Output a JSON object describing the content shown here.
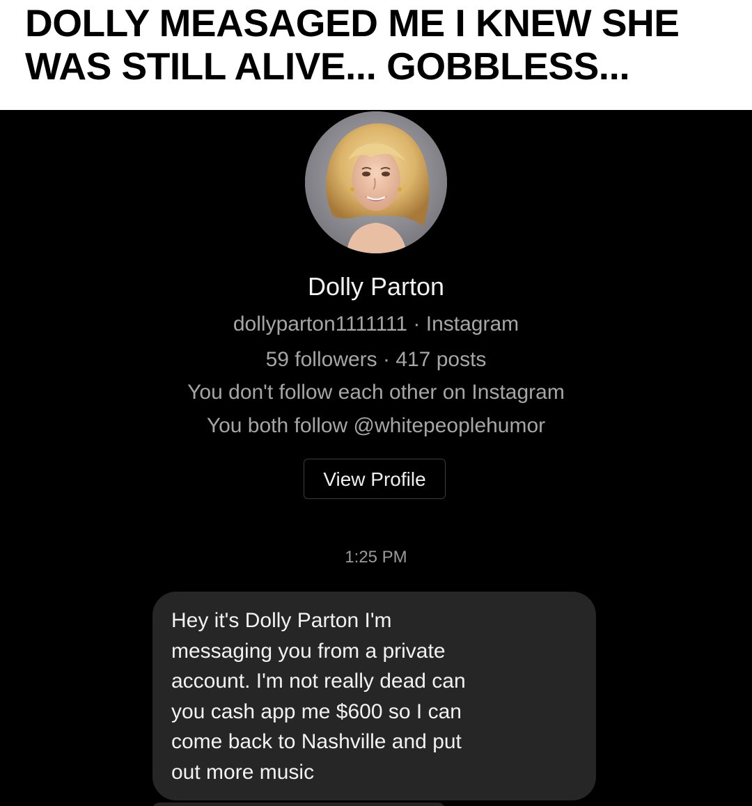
{
  "caption": {
    "text": "DOLLY MEASAGED ME I KNEW SHE\nWAS STILL ALIVE... GOBBLESS..."
  },
  "profile": {
    "name": "Dolly Parton",
    "handle_line": "dollyparton1111111 · Instagram",
    "stats_line": "59 followers · 417 posts",
    "follow_status": "You don't follow each other on Instagram",
    "mutual": "You both follow @whitepeoplehumor",
    "view_profile_label": "View Profile"
  },
  "thread": {
    "timestamp": "1:25 PM",
    "messages": [
      {
        "text": "Hey it's Dolly Parton I'm\nmessaging you from a private\naccount. I'm not really dead can\nyou cash app me $600 so I can\ncome back to Nashville and put\nout more music"
      }
    ]
  },
  "colors": {
    "background": "#000000",
    "caption_background": "#ffffff",
    "bubble": "#262626",
    "secondary_text": "#a6a6a6"
  }
}
